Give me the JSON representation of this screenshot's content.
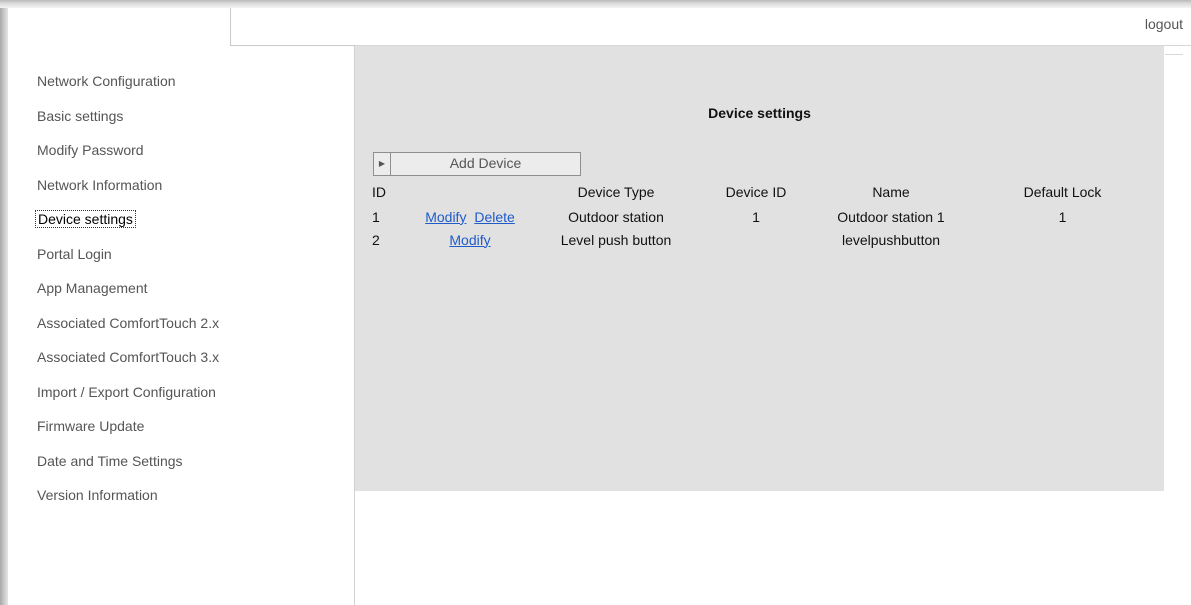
{
  "header": {
    "logout_label": "logout"
  },
  "sidebar": {
    "items": [
      {
        "label": "Network Configuration",
        "active": false
      },
      {
        "label": "Basic settings",
        "active": false
      },
      {
        "label": "Modify Password",
        "active": false
      },
      {
        "label": "Network Information",
        "active": false
      },
      {
        "label": "Device settings",
        "active": true
      },
      {
        "label": "Portal Login",
        "active": false
      },
      {
        "label": "App Management",
        "active": false
      },
      {
        "label": "Associated ComfortTouch 2.x",
        "active": false
      },
      {
        "label": "Associated ComfortTouch 3.x",
        "active": false
      },
      {
        "label": "Import / Export Configuration",
        "active": false
      },
      {
        "label": "Firmware Update",
        "active": false
      },
      {
        "label": "Date and Time Settings",
        "active": false
      },
      {
        "label": "Version Information",
        "active": false
      }
    ]
  },
  "main": {
    "title": "Device settings",
    "add_device_label": "Add Device",
    "add_device_icon": "triangle-right-icon",
    "table": {
      "columns": [
        "ID",
        "",
        "Device Type",
        "Device ID",
        "Name",
        "Default Lock"
      ],
      "rows": [
        {
          "id": "1",
          "actions": [
            "Modify",
            "Delete"
          ],
          "device_type": "Outdoor station",
          "device_id": "1",
          "name": "Outdoor station 1",
          "default_lock": "1"
        },
        {
          "id": "2",
          "actions": [
            "Modify"
          ],
          "device_type": "Level push button",
          "device_id": "",
          "name": "levelpushbutton",
          "default_lock": ""
        }
      ]
    }
  },
  "colors": {
    "panel_bg": "#e1e1e1",
    "link": "#1f5bc9",
    "nav_text": "#555555"
  }
}
